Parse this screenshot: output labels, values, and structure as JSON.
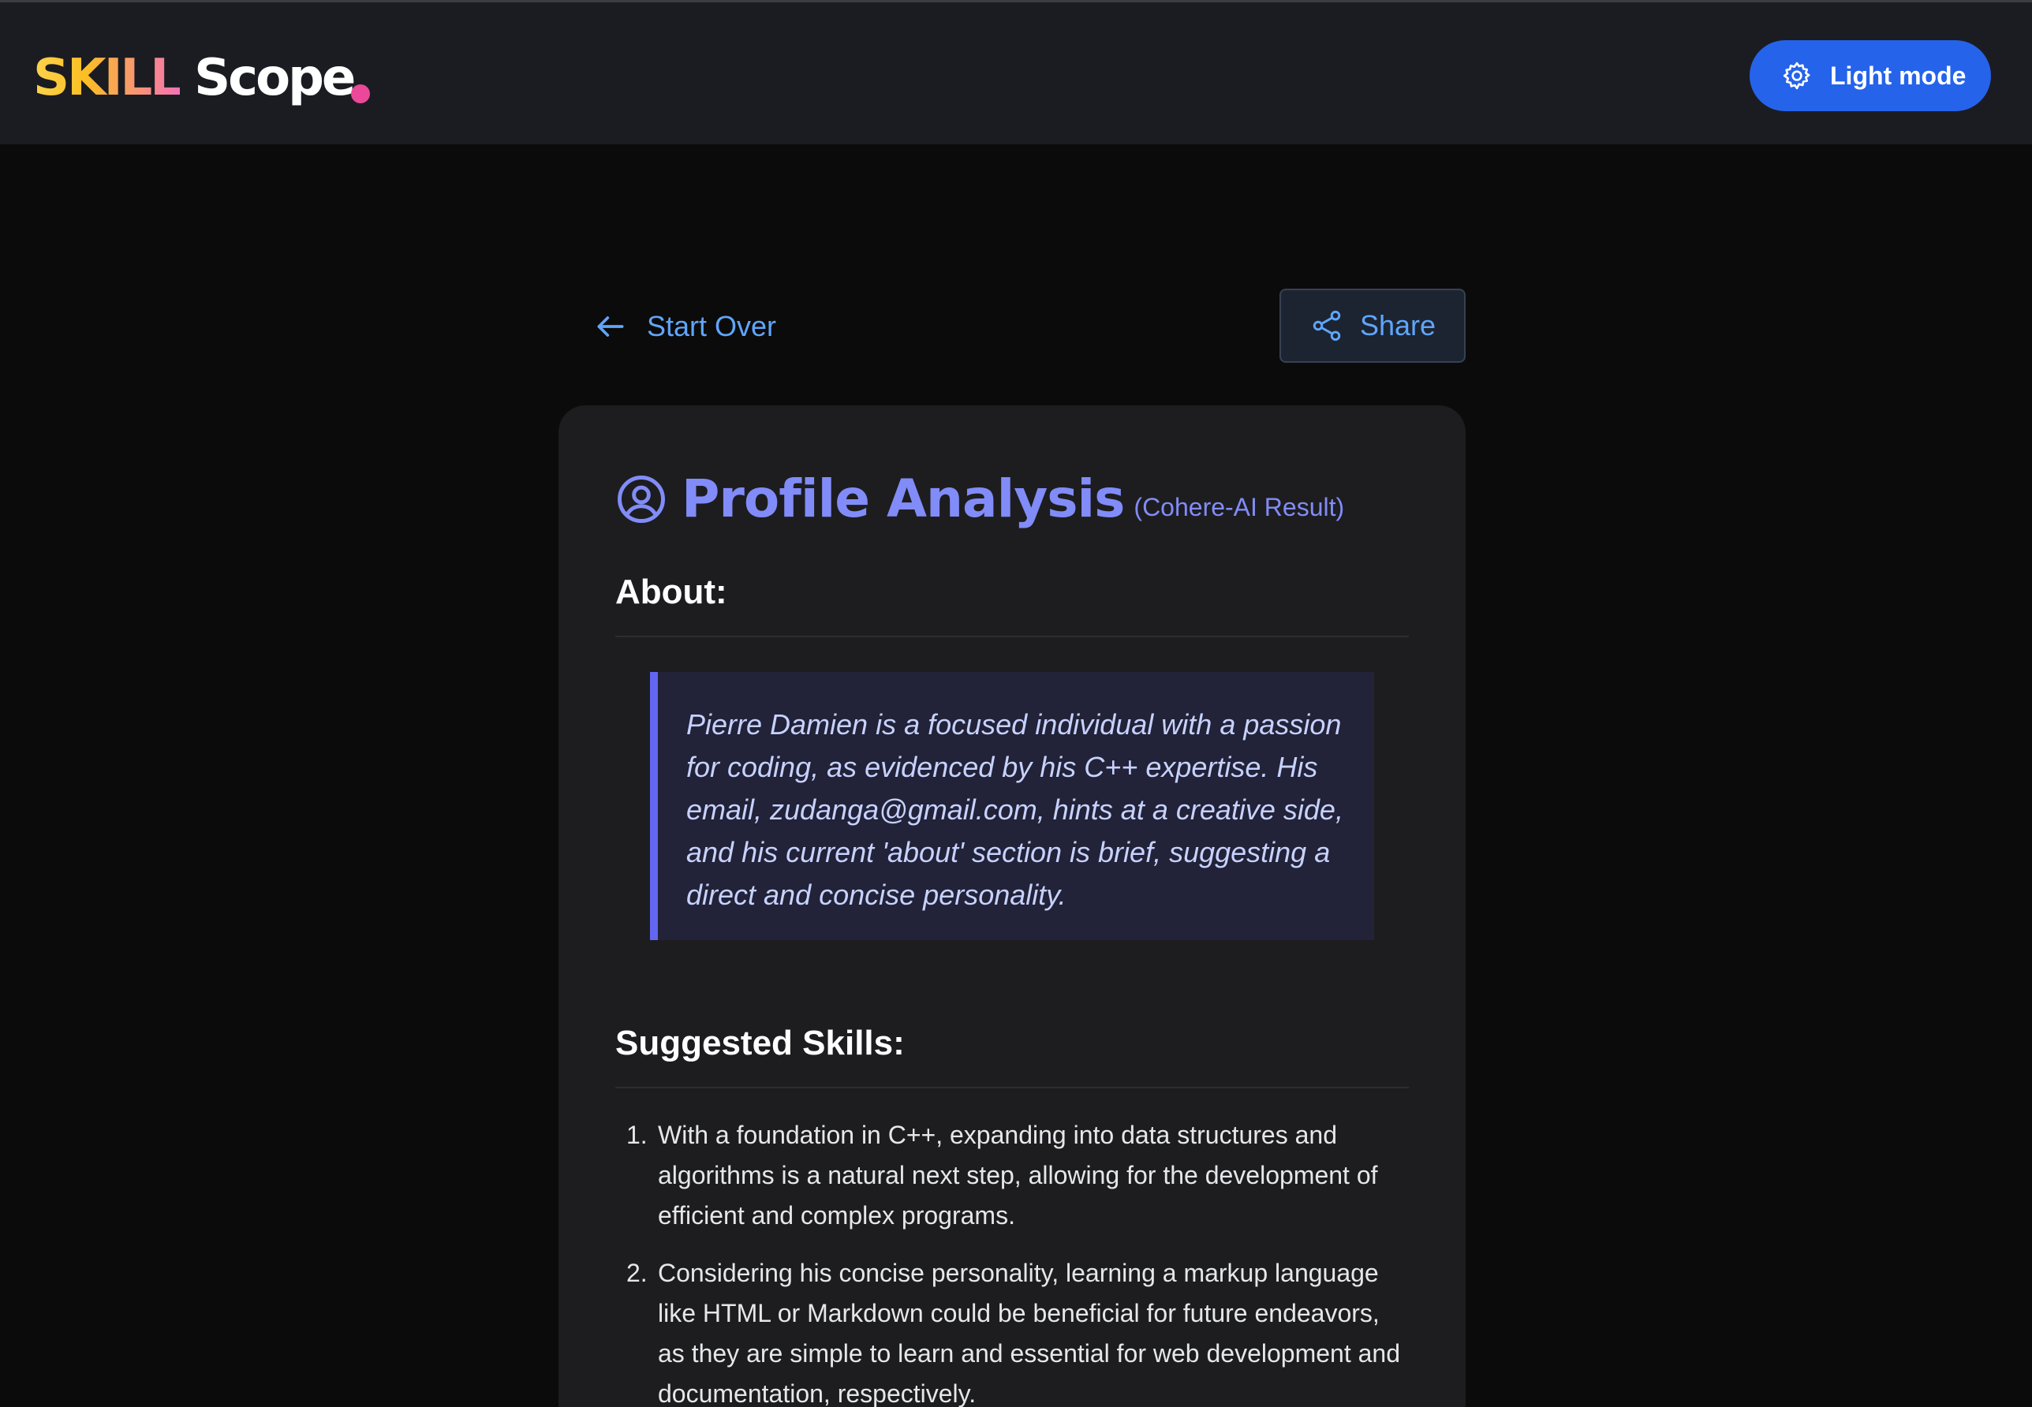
{
  "header": {
    "logo_part1": "SKILL",
    "logo_part2": "Scope",
    "theme_toggle_label": "Light mode",
    "brand_colors": {
      "gradient_start": "#fcd34d",
      "gradient_end": "#f472b6",
      "dot": "#ec4899",
      "button": "#2563eb"
    }
  },
  "actions": {
    "start_over_label": "Start Over",
    "share_label": "Share",
    "link_color": "#60a5fa"
  },
  "card": {
    "title": "Profile Analysis",
    "subtitle": "(Cohere-AI Result)",
    "about": {
      "heading": "About:",
      "text": "Pierre Damien is a focused individual with a passion for coding, as evidenced by his C++ expertise. His email, zudanga@gmail.com, hints at a creative side, and his current 'about' section is brief, suggesting a direct and concise personality."
    },
    "skills": {
      "heading": "Suggested Skills:",
      "items": [
        {
          "number": "1.",
          "text": "With a foundation in C++, expanding into data structures and algorithms is a natural next step, allowing for the development of efficient and complex programs."
        },
        {
          "number": "2.",
          "text": "Considering his concise personality, learning a markup language like HTML or Markdown could be beneficial for future endeavors, as they are simple to learn and essential for web development and documentation, respectively."
        }
      ]
    },
    "accent_color": "#818cf8"
  }
}
